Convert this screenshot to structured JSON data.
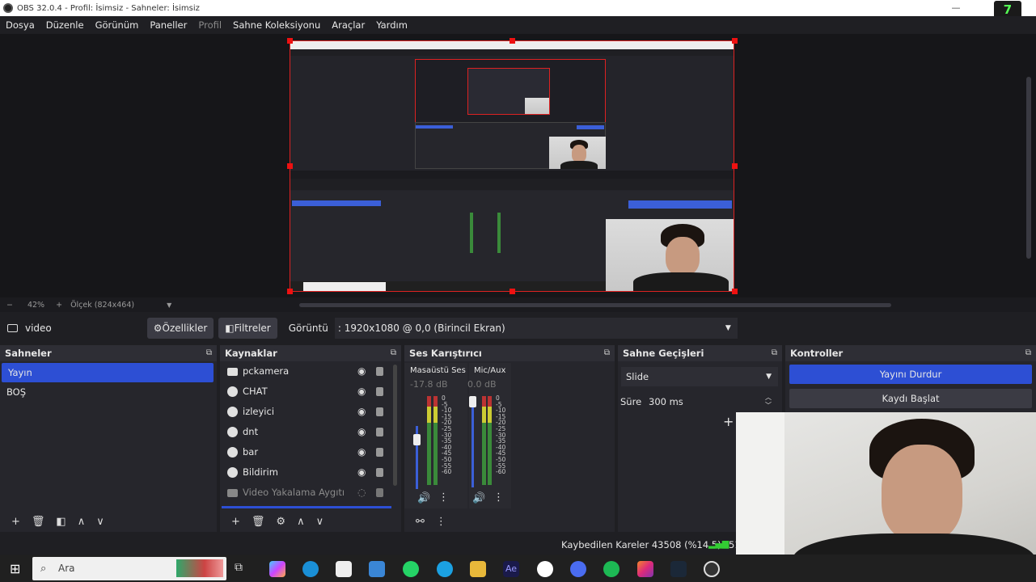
{
  "window": {
    "title": "OBS 32.0.4 - Profil: İsimsiz - Sahneler: İsimsiz",
    "minimize": "—",
    "maximize": "☐",
    "close": "✕",
    "badge": "7"
  },
  "menu": [
    "Dosya",
    "Düzenle",
    "Görünüm",
    "Paneller",
    "Profil",
    "Sahne Koleksiyonu",
    "Araçlar",
    "Yardım"
  ],
  "zoom": {
    "minus": "−",
    "level": "42%",
    "plus": "+",
    "scale": "Ölçek (824x464)"
  },
  "props_bar": {
    "source_name": "video",
    "properties_label": "Özellikler",
    "filters_label": "Filtreler",
    "display_label": "Görüntü",
    "display_value": ": 1920x1080 @ 0,0 (Birincil Ekran)"
  },
  "scenes": {
    "title": "Sahneler",
    "items": [
      "Yayın",
      "BOŞ"
    ]
  },
  "sources": {
    "title": "Kaynaklar",
    "items": [
      "pckamera",
      "CHAT",
      "izleyici",
      "dnt",
      "bar",
      "Bildirim",
      "Video Yakalama Aygıtı"
    ]
  },
  "mixer": {
    "title": "Ses Karıştırıcı",
    "channels": [
      {
        "name": "Masaüstü Ses",
        "db": "-17.8 dB",
        "level": 0.55
      },
      {
        "name": "Mic/Aux",
        "db": "0.0 dB",
        "level": 0.95
      }
    ],
    "scale": [
      "0",
      "-5",
      "-10",
      "-15",
      "-20",
      "-25",
      "-30",
      "-35",
      "-40",
      "-45",
      "-50",
      "-55",
      "-60"
    ]
  },
  "transitions": {
    "title": "Sahne Geçişleri",
    "type": "Slide",
    "duration_label": "Süre",
    "duration_value": "300 ms",
    "add": "+"
  },
  "controls": {
    "title": "Kontroller",
    "stop_stream": "Yayını Durdur",
    "start_record": "Kaydı Başlat"
  },
  "status": {
    "dropped_frames": "Kaybedilen Kareler 43508 (%14.5)",
    "extra": "51"
  },
  "taskbar": {
    "search_placeholder": "Ara"
  },
  "colors": {
    "accent": "#2d4fd4",
    "selection_border": "#dd2222",
    "panel": "#26262c",
    "bg": "#1f1f23"
  }
}
